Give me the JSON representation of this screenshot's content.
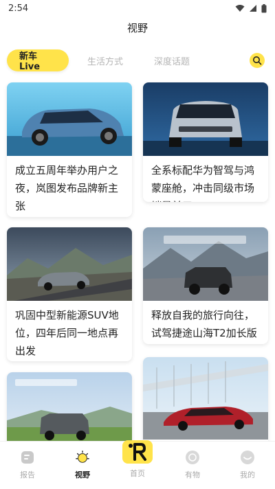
{
  "status_bar": {
    "time": "2:54"
  },
  "header": {
    "title": "视野"
  },
  "tabs": [
    {
      "label": "新车Live",
      "active": true
    },
    {
      "label": "生活方式",
      "active": false
    },
    {
      "label": "深度话题",
      "active": false
    }
  ],
  "feed": {
    "cards": [
      {
        "title": "成立五周年举办用户之夜，岚图发布品牌新主张",
        "image_icon": "blue-suv-photo"
      },
      {
        "title": "全系标配华为智驾与鸿蒙座舱，冲击同级市场销量前三",
        "image_icon": "silver-suv-stage-photo"
      },
      {
        "title": "巩固中型新能源SUV地位，四年后同一地点再出发",
        "image_icon": "suv-mountain-road-photo"
      },
      {
        "title": "释放自我的旅行向往，试驾捷途山海T2加长版",
        "image_icon": "offroad-suv-mountain-photo"
      },
      {
        "title": "",
        "image_icon": "offroad-suv-grassland-photo"
      },
      {
        "title": "",
        "image_icon": "red-sedan-bridge-photo"
      }
    ]
  },
  "bottom_nav": {
    "items": [
      {
        "label": "报告",
        "active": false
      },
      {
        "label": "视野",
        "active": true
      },
      {
        "label": "首页",
        "active": false
      },
      {
        "label": "有物",
        "active": false
      },
      {
        "label": "我的",
        "active": false
      }
    ]
  },
  "colors": {
    "accent": "#ffe34a",
    "inactive": "#b5b5b5"
  }
}
